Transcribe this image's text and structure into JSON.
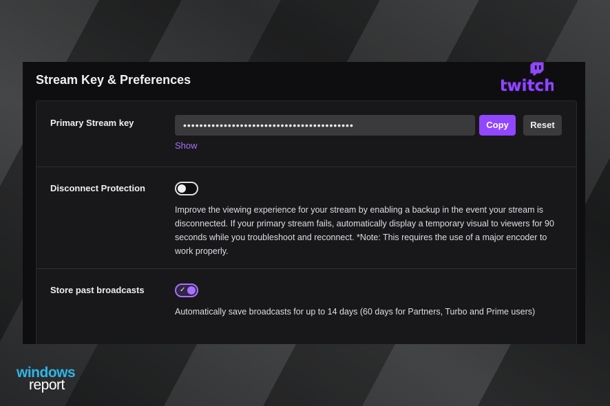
{
  "panel": {
    "title": "Stream Key & Preferences",
    "brand_logo": "twitch"
  },
  "stream_key": {
    "label": "Primary Stream key",
    "masked_value": "••••••••••••••••••••••••••••••••••••••••••",
    "copy_label": "Copy",
    "reset_label": "Reset",
    "show_label": "Show"
  },
  "disconnect_protection": {
    "label": "Disconnect Protection",
    "enabled": false,
    "description": "Improve the viewing experience for your stream by enabling a backup in the event your stream is disconnected. If your primary stream fails, automatically display a temporary visual to viewers for 90 seconds while you troubleshoot and reconnect. *Note: This requires the use of a major encoder to work properly."
  },
  "store_past_broadcasts": {
    "label": "Store past broadcasts",
    "enabled": true,
    "description": "Automatically save broadcasts for up to 14 days (60 days for Partners, Turbo and Prime users)"
  },
  "watermark": {
    "line1": "windows",
    "line2": "report"
  },
  "colors": {
    "accent": "#9147ff",
    "link": "#a970ff",
    "background": "#0e0e10",
    "card": "#18181b"
  }
}
